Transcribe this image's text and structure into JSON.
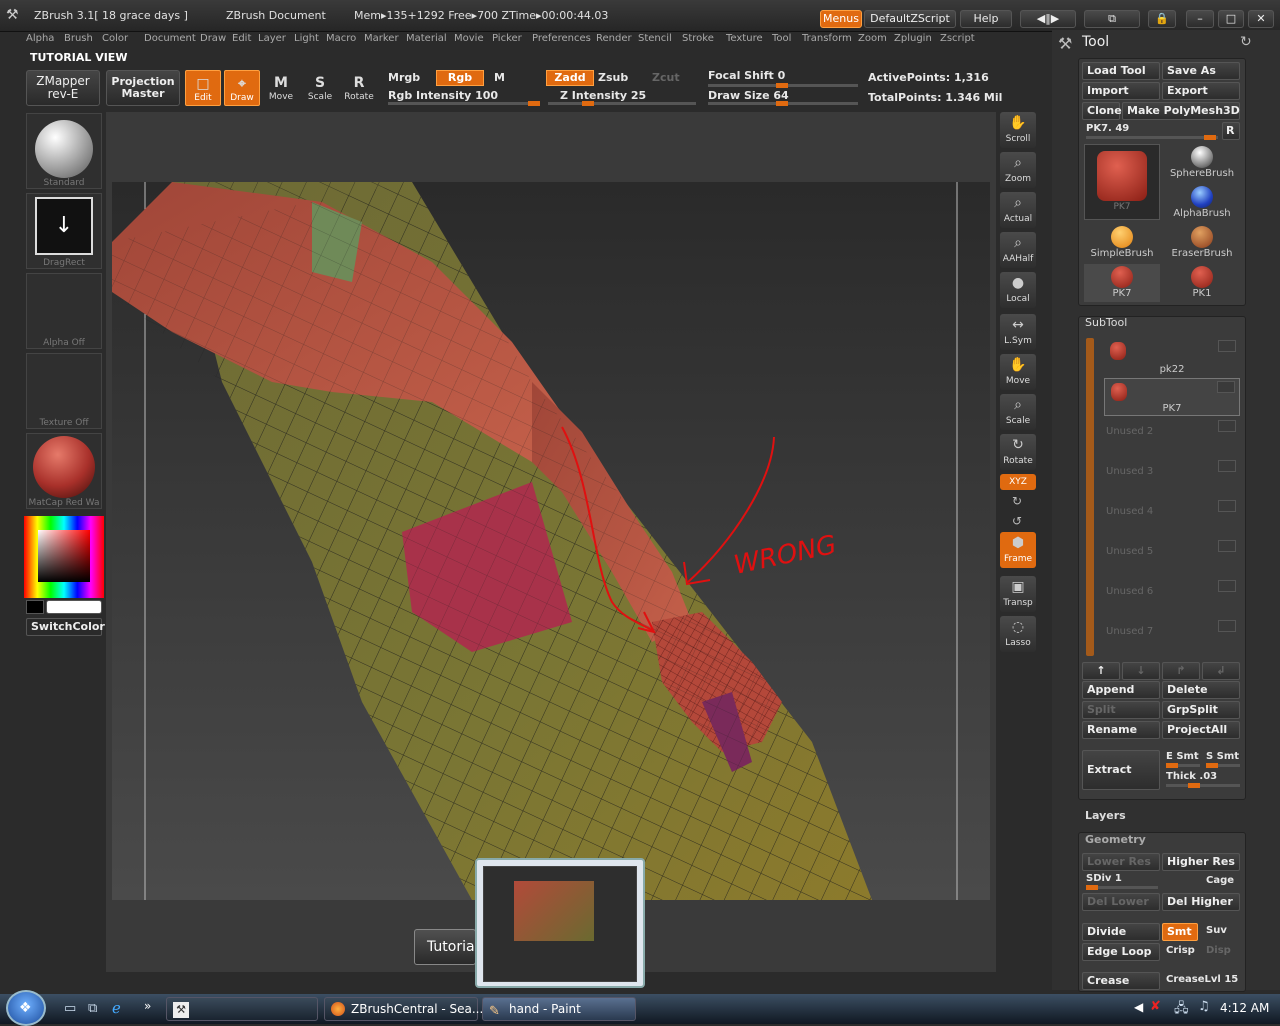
{
  "titlebar": {
    "app": "ZBrush  3.1[ 18 grace days ]",
    "document": "ZBrush Document",
    "stats": "Mem▸135+1292 Free▸700 ZTime▸00:00:44.03",
    "menus_btn": "Menus",
    "script_btn": "DefaultZScript",
    "help_btn": "Help"
  },
  "menubar": [
    "Alpha",
    "Brush",
    "Color",
    "Document",
    "Draw",
    "Edit",
    "Layer",
    "Light",
    "Macro",
    "Marker",
    "Material",
    "Movie",
    "Picker",
    "Preferences",
    "Render",
    "Stencil",
    "Stroke",
    "Texture",
    "Tool",
    "Transform",
    "Zoom",
    "Zplugin",
    "Zscript"
  ],
  "tutorial_view": "TUTORIAL VIEW",
  "toolbar": {
    "zmapper": "ZMapper\nrev-E",
    "projection": "Projection\nMaster",
    "modes": [
      {
        "label": "Edit",
        "on": true
      },
      {
        "label": "Draw",
        "on": true
      },
      {
        "label": "Move",
        "on": false
      },
      {
        "label": "Scale",
        "on": false
      },
      {
        "label": "Rotate",
        "on": false
      }
    ],
    "mrgb": "Mrgb",
    "rgb": "Rgb",
    "m": "M",
    "rgb_intensity": "Rgb Intensity 100",
    "zadd": "Zadd",
    "zsub": "Zsub",
    "zcut": "Zcut",
    "z_intensity": "Z Intensity 25",
    "focal_shift": "Focal Shift 0",
    "draw_size": "Draw Size 64",
    "active_points": "ActivePoints: 1,316",
    "total_points": "TotalPoints: 1.346 Mil"
  },
  "left_palette": {
    "brush": "Standard",
    "stroke": "DragRect",
    "alpha": "Alpha Off",
    "texture": "Texture Off",
    "material": "MatCap Red Wa",
    "switch_color": "SwitchColor"
  },
  "shelf": [
    {
      "label": "Scroll",
      "on": false
    },
    {
      "label": "Zoom",
      "on": false
    },
    {
      "label": "Actual",
      "on": false
    },
    {
      "label": "AAHalf",
      "on": false
    },
    {
      "label": "Local",
      "on": false
    },
    {
      "label": "L.Sym",
      "on": false
    },
    {
      "label": "Move",
      "on": false
    },
    {
      "label": "Scale",
      "on": false
    },
    {
      "label": "Rotate",
      "on": false
    },
    {
      "label": "XYZ",
      "on": true
    },
    {
      "label": "Frame",
      "on": true
    },
    {
      "label": "Transp",
      "on": false
    },
    {
      "label": "Lasso",
      "on": false
    }
  ],
  "annotation_text": "WRONG",
  "tool_panel": {
    "title": "Tool",
    "load_tool": "Load Tool",
    "save_as": "Save As",
    "import": "Import",
    "export": "Export",
    "clone": "Clone",
    "make_polymesh": "Make PolyMesh3D",
    "current_tool": "PK7. 49",
    "r_btn": "R",
    "thumbs": [
      "PK7",
      "SphereBrush",
      "AlphaBrush",
      "SimpleBrush",
      "EraserBrush",
      "PK7",
      "PK1"
    ],
    "subtool_title": "SubTool",
    "subtools": [
      "pk22",
      "PK7",
      "Unused 2",
      "Unused 3",
      "Unused 4",
      "Unused 5",
      "Unused 6",
      "Unused 7"
    ],
    "append": "Append",
    "delete": "Delete",
    "split": "Split",
    "grpsplit": "GrpSplit",
    "rename": "Rename",
    "projectall": "ProjectAll",
    "extract": "Extract",
    "e_smt": "E Smt",
    "s_smt": "S Smt",
    "thick": "Thick .03",
    "layers_title": "Layers",
    "geometry_title": "Geometry",
    "lower_res": "Lower Res",
    "higher_res": "Higher Res",
    "sdiv": "SDiv 1",
    "cage": "Cage",
    "del_lower": "Del Lower",
    "del_higher": "Del Higher",
    "divide": "Divide",
    "smt": "Smt",
    "suv": "Suv",
    "edge_loop": "Edge Loop",
    "crisp": "Crisp",
    "disp": "Disp",
    "crease": "Crease",
    "creaselvl": "CreaseLvl 15"
  },
  "tutorial_button": "Tutoria",
  "taskbar": {
    "task1": "ZBrushCentral - Sea...",
    "task2": "hand - Paint",
    "time": "4:12 AM"
  }
}
